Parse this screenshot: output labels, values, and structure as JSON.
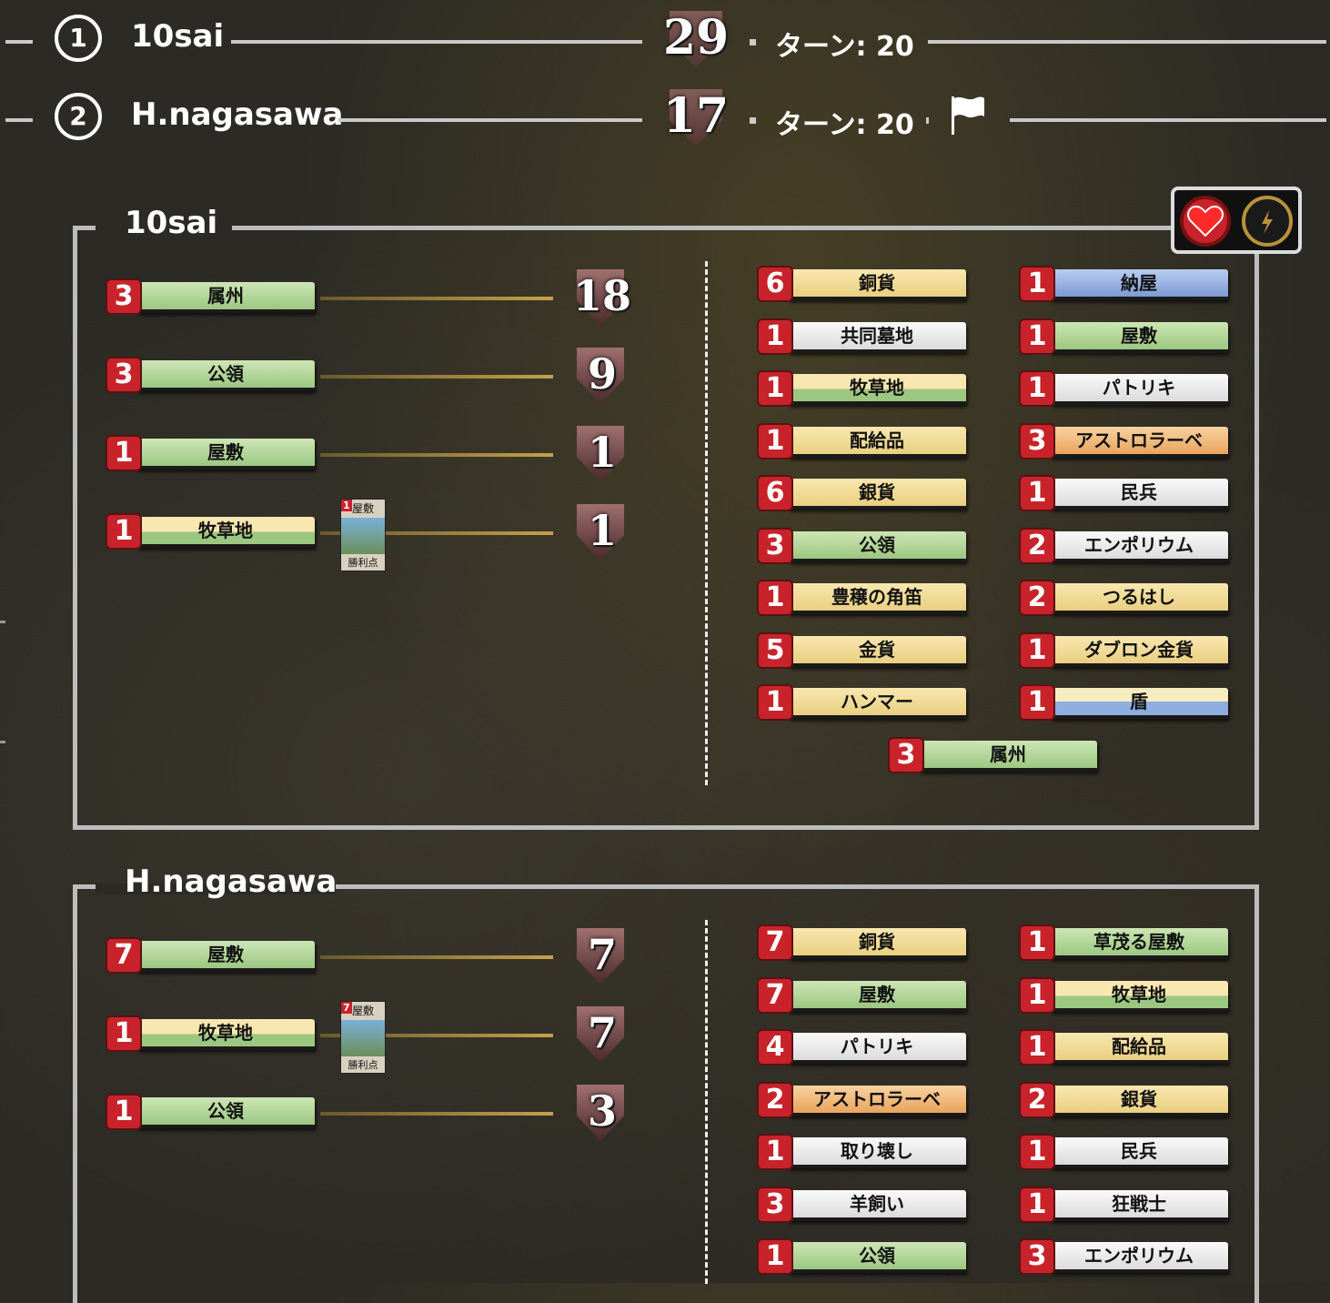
{
  "players": [
    {
      "rank": "1",
      "name": "10sai",
      "score": "29",
      "turn": "ターン: 20",
      "flag": false
    },
    {
      "rank": "2",
      "name": "H.nagasawa",
      "score": "17",
      "turn": "ターン: 20",
      "flag": true
    }
  ],
  "icons": {
    "heart": "heart-icon",
    "bolt": "lightning-icon",
    "flag": "flag-icon"
  },
  "colors": {
    "chip_number": "#c8232b",
    "panel_border": "#bdbdbd"
  },
  "panel1": {
    "title": "10sai",
    "vp_rows": [
      {
        "count": "3",
        "card": "属州",
        "vp": "18"
      },
      {
        "count": "3",
        "card": "公領",
        "vp": "9"
      },
      {
        "count": "1",
        "card": "屋敷",
        "vp": "1"
      },
      {
        "count": "1",
        "card": "牧草地",
        "vp": "1",
        "attached": {
          "badge": "1",
          "top": "屋敷",
          "bottom": "勝利点"
        }
      }
    ],
    "deck": [
      {
        "count": "6",
        "card": "銅貨"
      },
      {
        "count": "1",
        "card": "納屋"
      },
      {
        "count": "1",
        "card": "共同墓地"
      },
      {
        "count": "1",
        "card": "屋敷"
      },
      {
        "count": "1",
        "card": "牧草地"
      },
      {
        "count": "1",
        "card": "パトリキ"
      },
      {
        "count": "1",
        "card": "配給品"
      },
      {
        "count": "3",
        "card": "アストロラーベ"
      },
      {
        "count": "6",
        "card": "銀貨"
      },
      {
        "count": "1",
        "card": "民兵"
      },
      {
        "count": "3",
        "card": "公領"
      },
      {
        "count": "2",
        "card": "エンポリウム"
      },
      {
        "count": "1",
        "card": "豊穣の角笛"
      },
      {
        "count": "2",
        "card": "つるはし"
      },
      {
        "count": "5",
        "card": "金貨"
      },
      {
        "count": "1",
        "card": "ダブロン金貨"
      },
      {
        "count": "1",
        "card": "ハンマー"
      },
      {
        "count": "1",
        "card": "盾"
      },
      {
        "count": "3",
        "card": "属州"
      }
    ]
  },
  "panel2": {
    "title": "H.nagasawa",
    "vp_rows": [
      {
        "count": "7",
        "card": "屋敷",
        "vp": "7"
      },
      {
        "count": "1",
        "card": "牧草地",
        "vp": "7",
        "attached": {
          "badge": "7",
          "top": "屋敷",
          "bottom": "勝利点"
        }
      },
      {
        "count": "1",
        "card": "公領",
        "vp": "3"
      }
    ],
    "deck": [
      {
        "count": "7",
        "card": "銅貨"
      },
      {
        "count": "1",
        "card": "草茂る屋敷"
      },
      {
        "count": "7",
        "card": "屋敷"
      },
      {
        "count": "1",
        "card": "牧草地"
      },
      {
        "count": "4",
        "card": "パトリキ"
      },
      {
        "count": "1",
        "card": "配給品"
      },
      {
        "count": "2",
        "card": "アストロラーベ"
      },
      {
        "count": "2",
        "card": "銀貨"
      },
      {
        "count": "1",
        "card": "取り壊し"
      },
      {
        "count": "1",
        "card": "民兵"
      },
      {
        "count": "3",
        "card": "羊飼い"
      },
      {
        "count": "1",
        "card": "狂戦士"
      },
      {
        "count": "1",
        "card": "公領"
      },
      {
        "count": "3",
        "card": "エンポリウム"
      }
    ]
  }
}
